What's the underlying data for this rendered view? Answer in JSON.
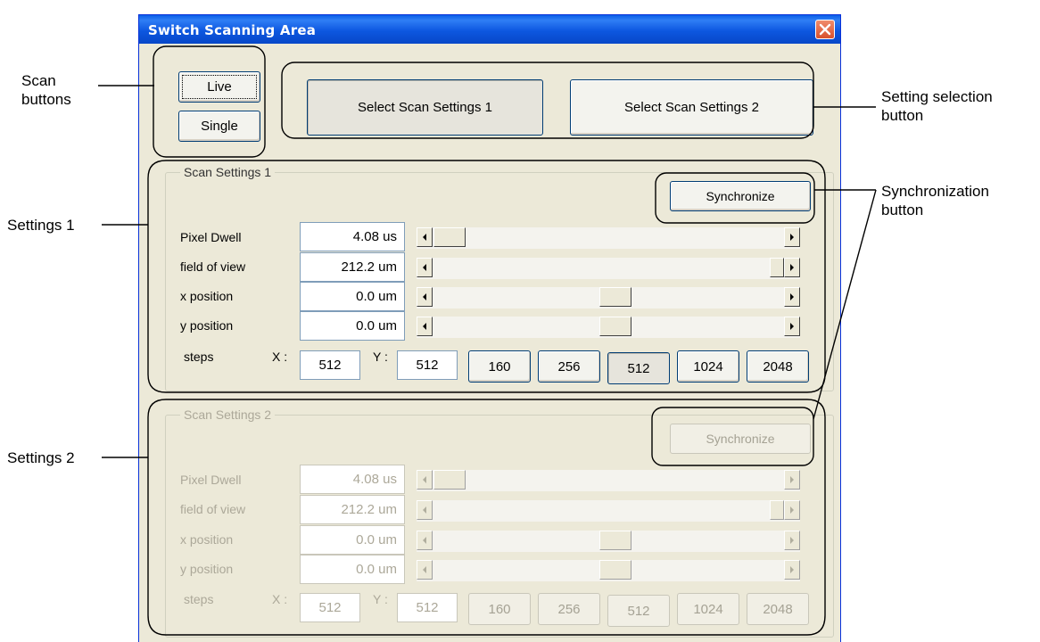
{
  "window": {
    "title": "Switch Scanning Area"
  },
  "scan_buttons": {
    "live": "Live",
    "single": "Single"
  },
  "setting_select": {
    "btn1": "Select Scan Settings 1",
    "btn2": "Select Scan Settings 2"
  },
  "settings1": {
    "title": "Scan Settings 1",
    "sync": "Synchronize",
    "rows": [
      {
        "label": "Pixel Dwell",
        "value": "4.08 us"
      },
      {
        "label": "field of view",
        "value": "212.2 um"
      },
      {
        "label": "x position",
        "value": "0.0 um"
      },
      {
        "label": "y position",
        "value": "0.0 um"
      }
    ],
    "steps": {
      "label": "steps",
      "x_label": "X :",
      "x_value": "512",
      "y_label": "Y :",
      "y_value": "512",
      "buttons": [
        "160",
        "256",
        "512",
        "1024",
        "2048"
      ]
    }
  },
  "settings2": {
    "title": "Scan Settings 2",
    "sync": "Synchronize",
    "rows": [
      {
        "label": "Pixel Dwell",
        "value": "4.08 us"
      },
      {
        "label": "field of view",
        "value": "212.2 um"
      },
      {
        "label": "x position",
        "value": "0.0 um"
      },
      {
        "label": "y position",
        "value": "0.0 um"
      }
    ],
    "steps": {
      "label": "steps",
      "x_label": "X :",
      "x_value": "512",
      "y_label": "Y :",
      "y_value": "512",
      "buttons": [
        "160",
        "256",
        "512",
        "1024",
        "2048"
      ]
    }
  },
  "annotations": {
    "scan_buttons": "Scan\nbuttons",
    "setting_selection": "Setting selection\nbutton",
    "synchronization": "Synchronization\nbutton",
    "settings1": "Settings 1",
    "settings2": "Settings 2"
  },
  "colors": {
    "titlebar": "#0a5fe8",
    "window_bg": "#ece9d8",
    "close": "#d8512d"
  }
}
